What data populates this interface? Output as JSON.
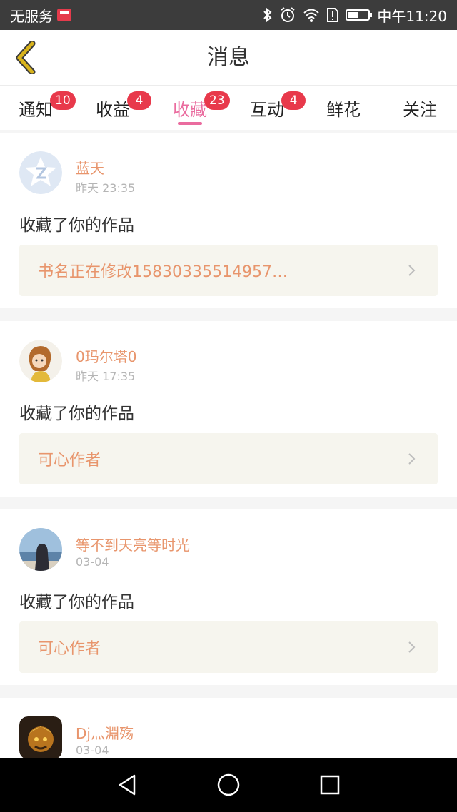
{
  "status_bar": {
    "carrier": "无服务",
    "time": "中午11:20",
    "icons": [
      "bluetooth-icon",
      "alarm-icon",
      "wifi-icon",
      "sim-alert-icon",
      "battery-icon"
    ]
  },
  "header": {
    "title": "消息",
    "back_icon": "chevron-left-icon",
    "accent_color": "#d8b31c"
  },
  "tabs": [
    {
      "label": "通知",
      "badge": "10",
      "active": false
    },
    {
      "label": "收益",
      "badge": "4",
      "active": false
    },
    {
      "label": "收藏",
      "badge": "23",
      "active": true
    },
    {
      "label": "互动",
      "badge": "4",
      "active": false
    },
    {
      "label": "鲜花",
      "badge": "",
      "active": false
    },
    {
      "label": "关注",
      "badge": "",
      "active": false
    }
  ],
  "colors": {
    "active_tab": "#ea6c9f",
    "badge": "#e8394b",
    "username": "#e8956c",
    "work_box_bg": "#f6f5ee"
  },
  "messages": [
    {
      "user": "蓝天",
      "time": "昨天 23:35",
      "action": "收藏了你的作品",
      "work": "书名正在修改15830335514957…",
      "avatar": "qq-default-avatar"
    },
    {
      "user": "0玛尔塔0",
      "time": "昨天 17:35",
      "action": "收藏了你的作品",
      "work": "可心作者",
      "avatar": "illustrated-girl-avatar"
    },
    {
      "user": "等不到天亮等时光",
      "time": "03-04",
      "action": "收藏了你的作品",
      "work": "可心作者",
      "avatar": "seaside-photo-avatar"
    },
    {
      "user": "Dj灬淵殇",
      "time": "03-04",
      "action": "",
      "work": "",
      "avatar": "game-character-avatar"
    }
  ],
  "nav_bar": {
    "back": "triangle-back-icon",
    "home": "circle-home-icon",
    "recents": "square-recents-icon"
  }
}
